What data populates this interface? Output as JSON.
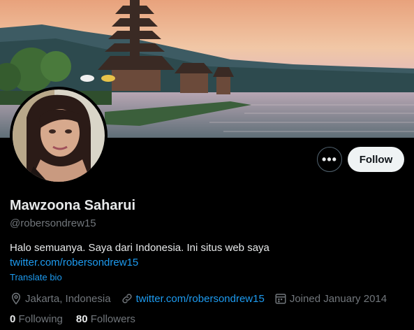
{
  "profile": {
    "name": "Mawzoona Saharui",
    "handle": "@robersondrew15",
    "bio": "Halo semuanya. Saya dari Indonesia. Ini situs web saya",
    "bio_link": "twitter.com/robersondrew15",
    "translate_label": "Translate bio",
    "location": "Jakarta, Indonesia",
    "website": "twitter.com/robersondrew15",
    "joined": "Joined January 2014",
    "following_count": "0",
    "following_label": "Following",
    "followers_count": "80",
    "followers_label": "Followers"
  },
  "actions": {
    "more_label": "•••",
    "follow_label": "Follow"
  },
  "icons": {
    "location": "location-pin-icon",
    "website": "link-icon",
    "joined": "calendar-icon",
    "more": "more-icon"
  },
  "colors": {
    "background": "#000000",
    "link": "#1d9bf0",
    "secondary_text": "#71767b",
    "follow_button_bg": "#eff3f4"
  }
}
